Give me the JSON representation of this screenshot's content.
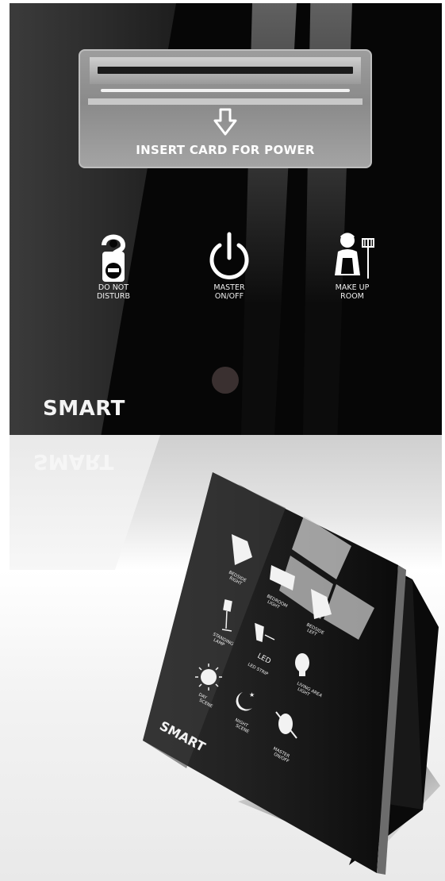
{
  "top_panel": {
    "card_slot_text": "INSERT CARD FOR POWER",
    "buttons": [
      {
        "icon": "do-not-disturb-hanger-icon",
        "label_line1": "DO NOT",
        "label_line2": "DISTURB"
      },
      {
        "icon": "power-icon",
        "label_line1": "MASTER",
        "label_line2": "ON/OFF"
      },
      {
        "icon": "maid-icon",
        "label_line1": "MAKE UP",
        "label_line2": "ROOM"
      }
    ],
    "brand": "SMART",
    "brand_reflection": "SMART"
  },
  "device": {
    "brand": "SMART",
    "buttons": [
      {
        "icon": "bed-icon",
        "label_line1": "BEDSIDE",
        "label_line2": "RIGHT"
      },
      {
        "icon": "bed-light-icon",
        "label_line1": "BEDROOM",
        "label_line2": "LIGHT"
      },
      {
        "icon": "bed-icon",
        "label_line1": "BEDSIDE",
        "label_line2": "LEFT"
      },
      {
        "icon": "floor-lamp-icon",
        "label_line1": "STANDING",
        "label_line2": "LAMP"
      },
      {
        "icon": "led-strip-icon",
        "label_line1": "LED STRIP",
        "label_line2": ""
      },
      {
        "icon": "light-bulb-icon",
        "label_line1": "LIVING AREA",
        "label_line2": "LIGHT"
      },
      {
        "icon": "sun-icon",
        "label_line1": "DAY",
        "label_line2": "SCENE"
      },
      {
        "icon": "moon-icon",
        "label_line1": "NIGHT",
        "label_line2": "SCENE"
      },
      {
        "icon": "master-off-icon",
        "label_line1": "MASTER",
        "label_line2": "ON/OFF"
      }
    ],
    "led_label": "LED"
  },
  "colors": {
    "panel": "#060606",
    "text": "#f2f2f2",
    "slot": "#9a9a9a"
  }
}
